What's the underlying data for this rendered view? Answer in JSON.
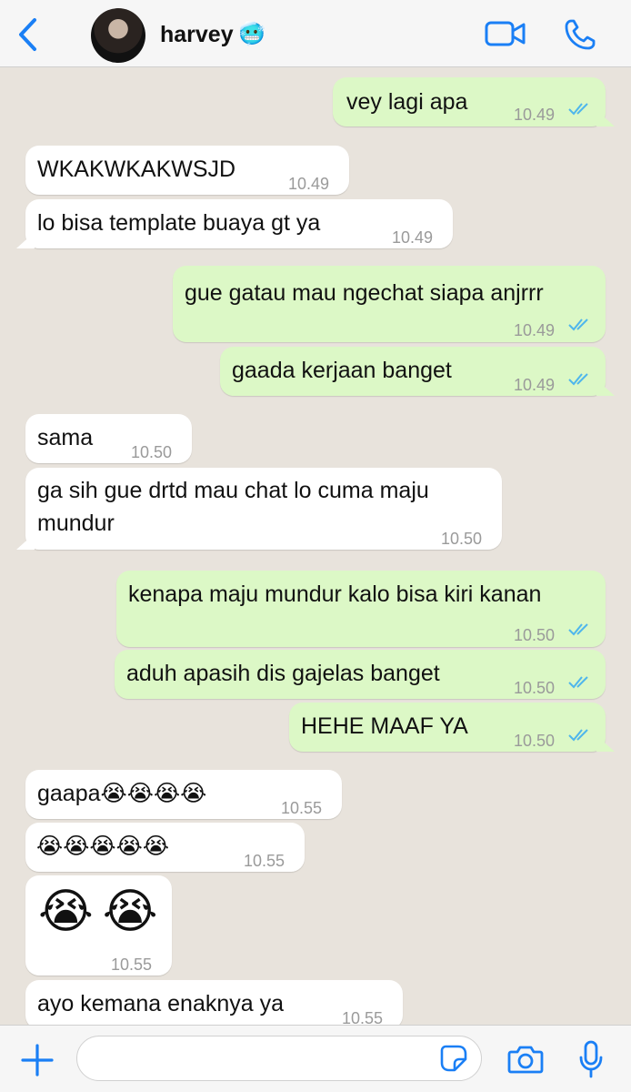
{
  "header": {
    "contact_name": "harvey",
    "contact_emoji": "🥶",
    "icons": {
      "back": "chevron-left-icon",
      "video": "video-call-icon",
      "call": "phone-icon"
    }
  },
  "colors": {
    "accent": "#1a7ff5",
    "outgoing_bubble": "#dcf8c6",
    "incoming_bubble": "#ffffff",
    "chat_background": "#e8e3dc",
    "read_ticks": "#4fb6ec"
  },
  "messages": [
    {
      "direction": "outgoing",
      "text": "vey lagi apa",
      "time": "10.49",
      "status": "read"
    },
    {
      "direction": "incoming",
      "text": "WKAKWKAKWSJD",
      "time": "10.49"
    },
    {
      "direction": "incoming",
      "text": "lo bisa template buaya gt ya",
      "time": "10.49"
    },
    {
      "direction": "outgoing",
      "text": "gue gatau mau ngechat siapa anjrrr",
      "time": "10.49",
      "status": "read"
    },
    {
      "direction": "outgoing",
      "text": "gaada kerjaan banget",
      "time": "10.49",
      "status": "read"
    },
    {
      "direction": "incoming",
      "text": "sama",
      "time": "10.50"
    },
    {
      "direction": "incoming",
      "text": "ga sih gue drtd mau chat lo cuma maju mundur",
      "time": "10.50"
    },
    {
      "direction": "outgoing",
      "text": "kenapa maju mundur kalo bisa kiri kanan",
      "time": "10.50",
      "status": "read"
    },
    {
      "direction": "outgoing",
      "text": "aduh apasih dis gajelas banget",
      "time": "10.50",
      "status": "read"
    },
    {
      "direction": "outgoing",
      "text": "HEHE MAAF YA",
      "time": "10.50",
      "status": "read"
    },
    {
      "direction": "incoming",
      "text": "gaapa😭😭😭😭",
      "time": "10.55"
    },
    {
      "direction": "incoming",
      "text": "😭😭😭😭😭",
      "time": "10.55"
    },
    {
      "direction": "incoming",
      "text": "😭😭",
      "time": "10.55"
    },
    {
      "direction": "incoming",
      "text": "ayo kemana enaknya ya",
      "time": "10.55"
    }
  ],
  "composer": {
    "placeholder": "",
    "icons": {
      "attach": "plus-icon",
      "sticker": "sticker-icon",
      "camera": "camera-icon",
      "mic": "microphone-icon"
    }
  }
}
